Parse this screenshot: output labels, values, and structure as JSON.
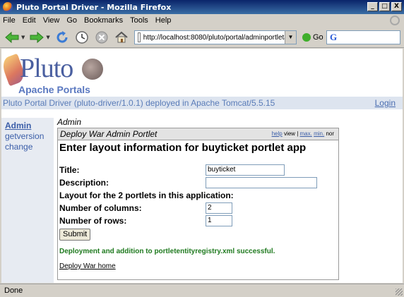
{
  "window": {
    "title": "Pluto Portal Driver - Mozilla Firefox",
    "controls": [
      "_",
      "□",
      "X"
    ]
  },
  "menu": [
    "File",
    "Edit",
    "View",
    "Go",
    "Bookmarks",
    "Tools",
    "Help"
  ],
  "toolbar": {
    "url": "http://localhost:8080/pluto/portal/adminportletapp",
    "go_label": "Go",
    "search_engine_letter": "G"
  },
  "logo": {
    "title": "Pluto",
    "subtitle": "Apache Portals"
  },
  "header": {
    "info": "Pluto Portal Driver (pluto-driver/1.0.1) deployed in Apache Tomcat/5.5.15",
    "login": "Login"
  },
  "nav": {
    "items": [
      {
        "label": "Admin",
        "active": true
      },
      {
        "label": "getversion",
        "active": false
      },
      {
        "label": "change",
        "active": false
      }
    ]
  },
  "page": {
    "title": "Admin"
  },
  "portlet": {
    "title": "Deploy War Admin Portlet",
    "controls": {
      "help": "help",
      "view": "view",
      "sep": "|",
      "max": "max.",
      "min": "min.",
      "nor": "nor"
    },
    "heading": "Enter layout information for buyticket portlet app",
    "form": {
      "title_label": "Title:",
      "title_value": "buyticket",
      "description_label": "Description:",
      "description_value": "",
      "layout_label": "Layout for the 2 portlets in this application:",
      "columns_label": "Number of columns:",
      "columns_value": "2",
      "rows_label": "Number of rows:",
      "rows_value": "1",
      "submit_label": "Submit"
    },
    "success_message": "Deployment and addition to portletentityregistry.xml successful.",
    "home_link": "Deploy War home"
  },
  "status": {
    "text": "Done"
  }
}
